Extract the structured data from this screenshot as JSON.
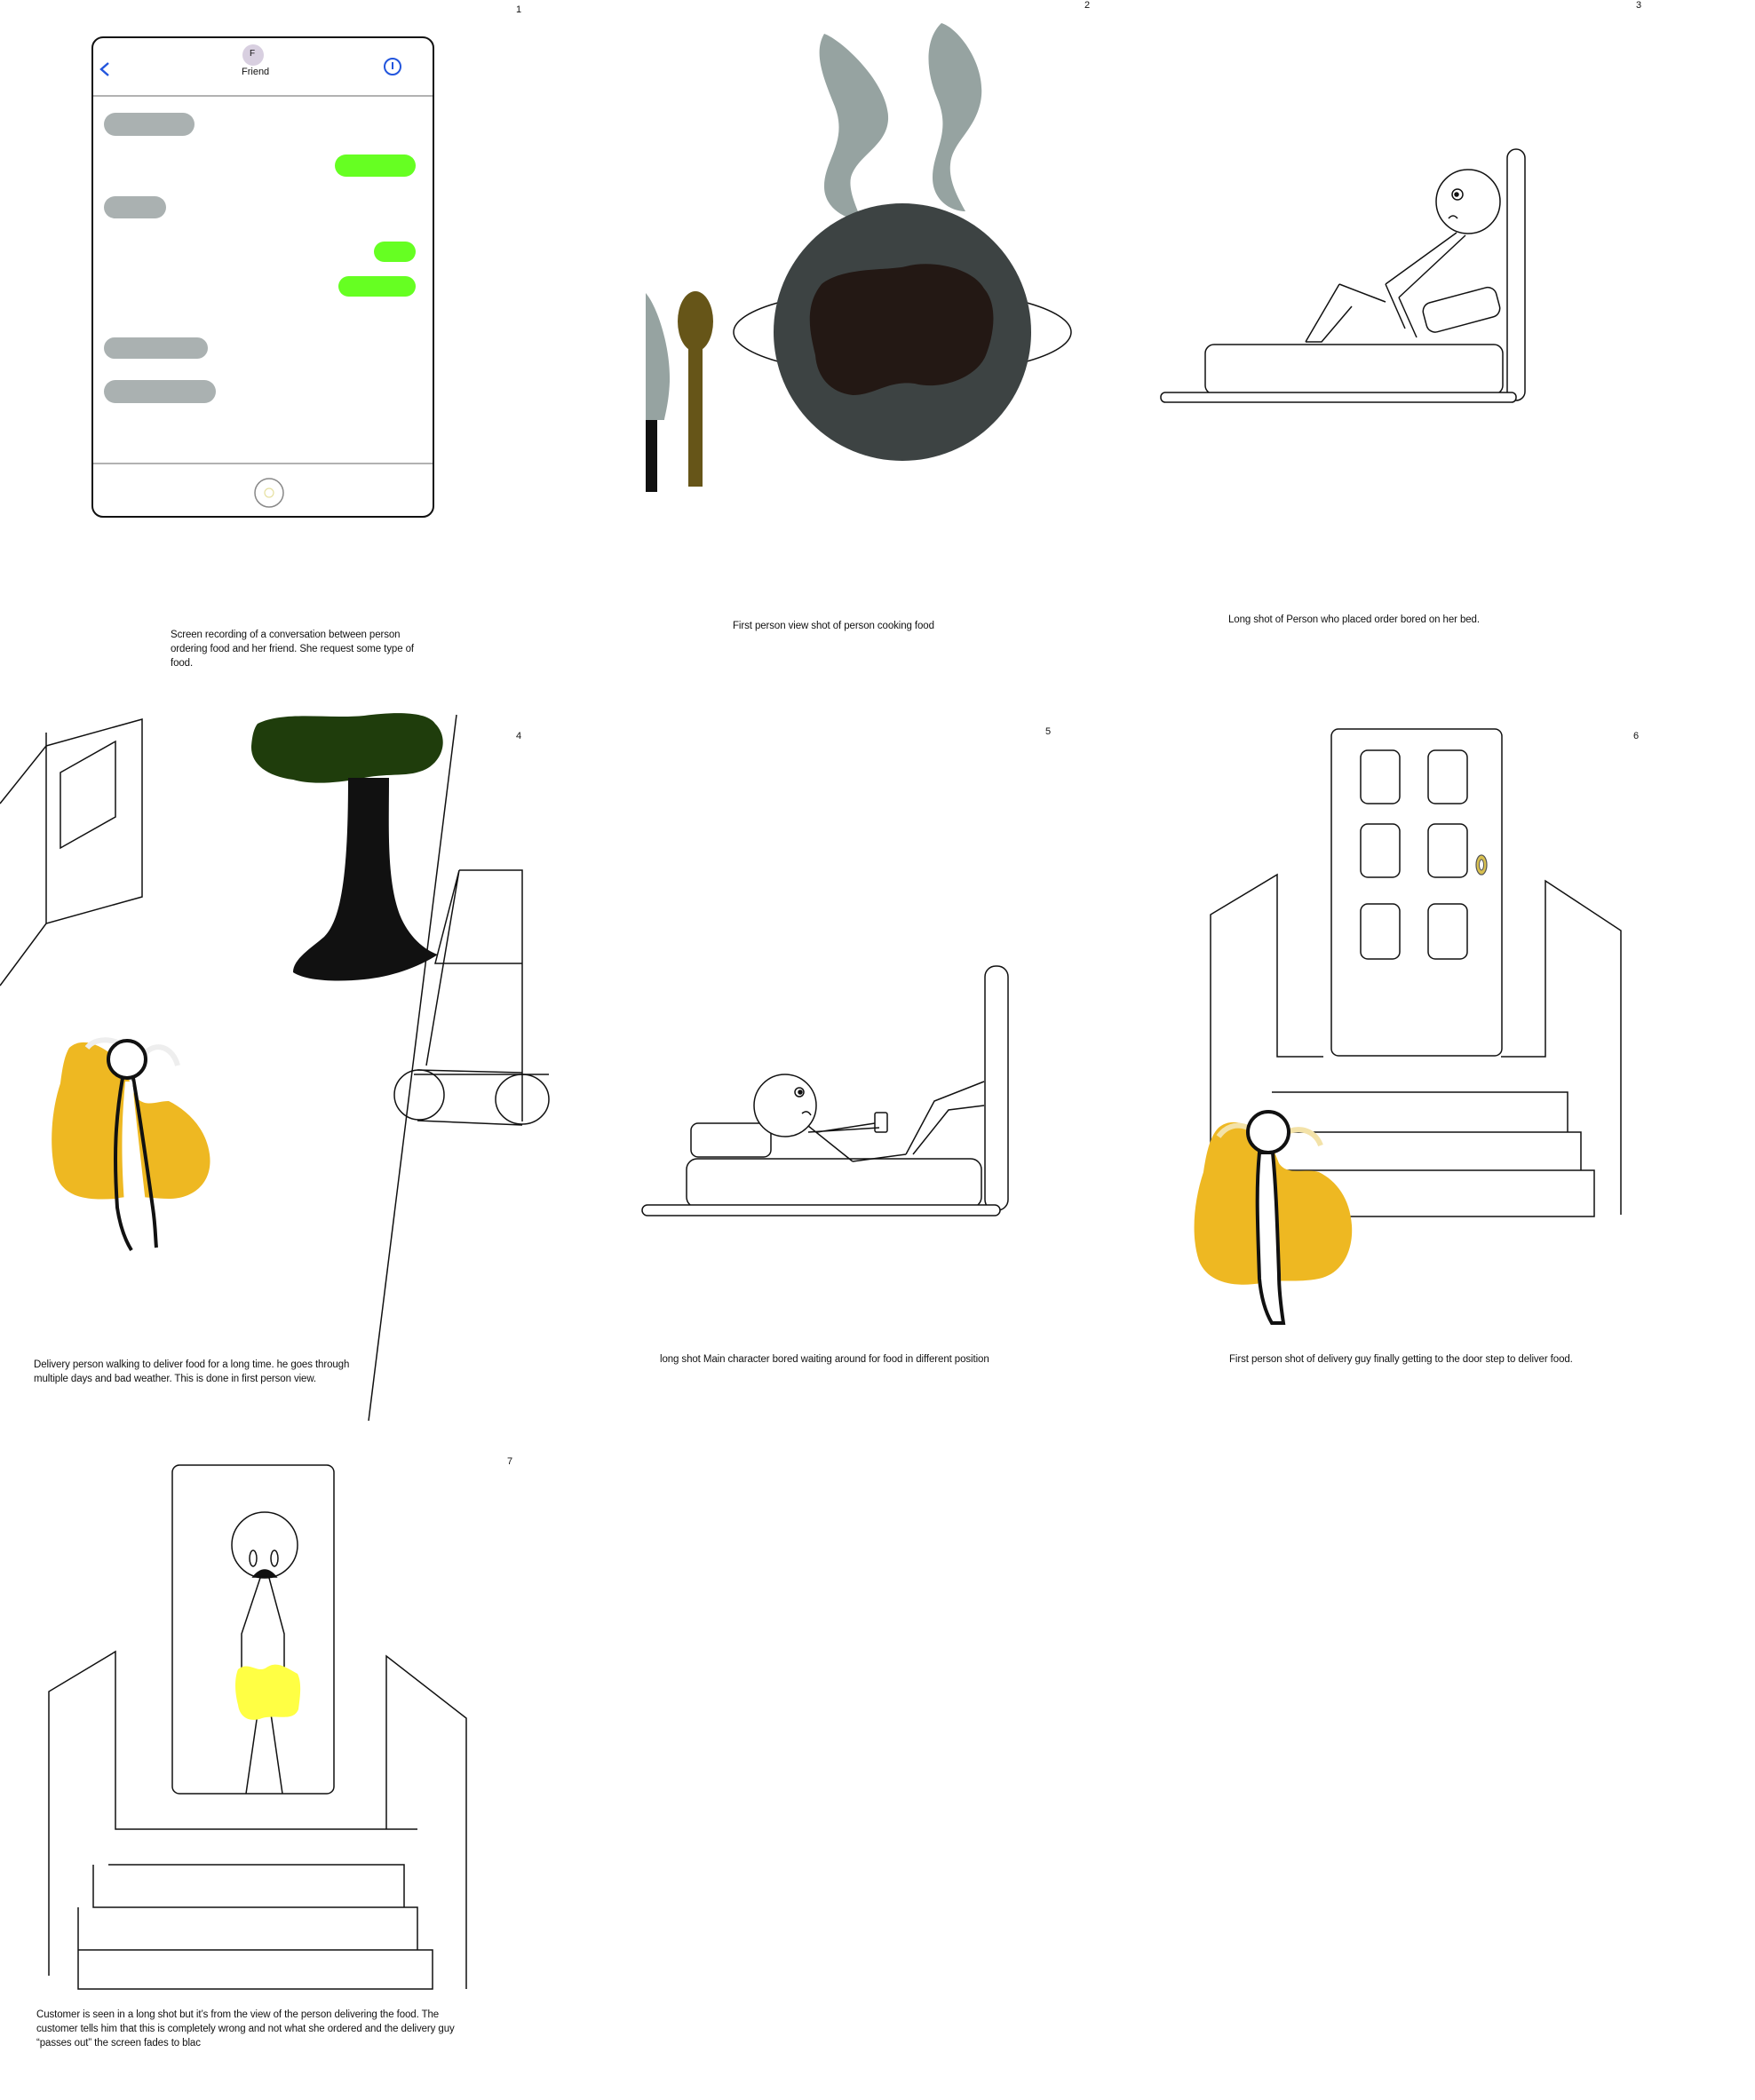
{
  "colors": {
    "sent_bubble": "#66ff22",
    "received_bubble": "#aab1b1",
    "ios_blue": "#2255dd",
    "bag_yellow": "#eeb822",
    "bag_bright_yellow": "#ffff44",
    "tree_canopy": "#1f3d0c",
    "plate": "#3d4343",
    "food": "#231814",
    "knife_spoon": "#665518",
    "steam": "#96a3a1"
  },
  "panels": [
    {
      "number": "1",
      "caption": "Screen recording of a conversation between person ordering food and her friend. She request some type of food.",
      "phone": {
        "back_icon": "chevron-left-icon",
        "avatar_letter": "F",
        "contact_name": "Friend",
        "info_icon": "info-icon",
        "home_icon": "home-button-icon"
      }
    },
    {
      "number": "2",
      "caption": "First person view shot of person cooking food"
    },
    {
      "number": "3",
      "caption": "Long shot of Person who placed order bored on her bed."
    },
    {
      "number": "4",
      "caption": "Delivery person walking to deliver food for a long time. he goes through multiple days and bad weather. This is done in first person view."
    },
    {
      "number": "5",
      "caption": "long shot Main character bored waiting around for food in different position"
    },
    {
      "number": "6",
      "caption": "First person shot of delivery guy finally getting to the door step to deliver food."
    },
    {
      "number": "7",
      "caption": "Customer is seen in a long shot but it’s from the view of the person delivering the food. The customer tells him that this is completely wrong and not what she ordered and the delivery guy “passes out” the screen fades to blac"
    }
  ]
}
